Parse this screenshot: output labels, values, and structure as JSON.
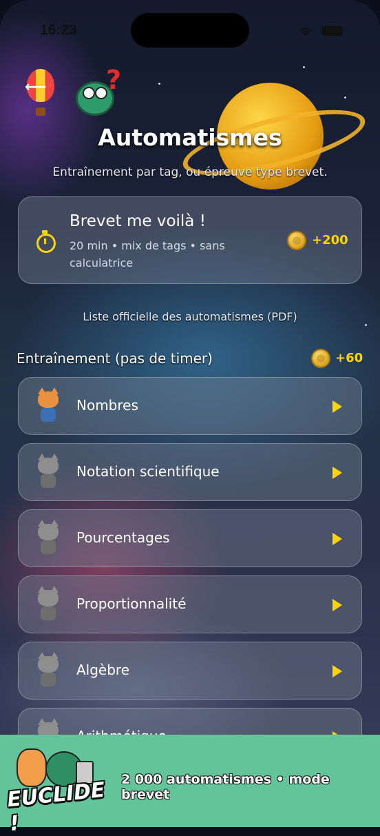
{
  "status_bar": {
    "time": "16:23"
  },
  "header": {
    "title": "Automatismes",
    "subtitle": "Entraînement par tag, ou épreuve type brevet."
  },
  "brevet_card": {
    "title": "Brevet me voilà !",
    "description": "20 min • mix de tags • sans calculatrice",
    "reward": "+200",
    "accent_color": "#ffd400"
  },
  "pdf_link": "Liste officielle des automatismes (PDF)",
  "training": {
    "title": "Entraînement (pas de timer)",
    "reward": "+60",
    "items": [
      {
        "label": "Nombres",
        "mascot": "orange-cat"
      },
      {
        "label": "Notation scientifique",
        "mascot": "grey-cat"
      },
      {
        "label": "Pourcentages",
        "mascot": "grey-cat"
      },
      {
        "label": "Proportionnalité",
        "mascot": "grey-cat"
      },
      {
        "label": "Algèbre",
        "mascot": "grey-cat"
      },
      {
        "label": "Arithmétique",
        "mascot": "grey-cat"
      }
    ]
  },
  "banner": {
    "logo_text": "EUCLIDE !",
    "text": "2 000 automatismes • mode brevet",
    "background": "#63c49a"
  }
}
